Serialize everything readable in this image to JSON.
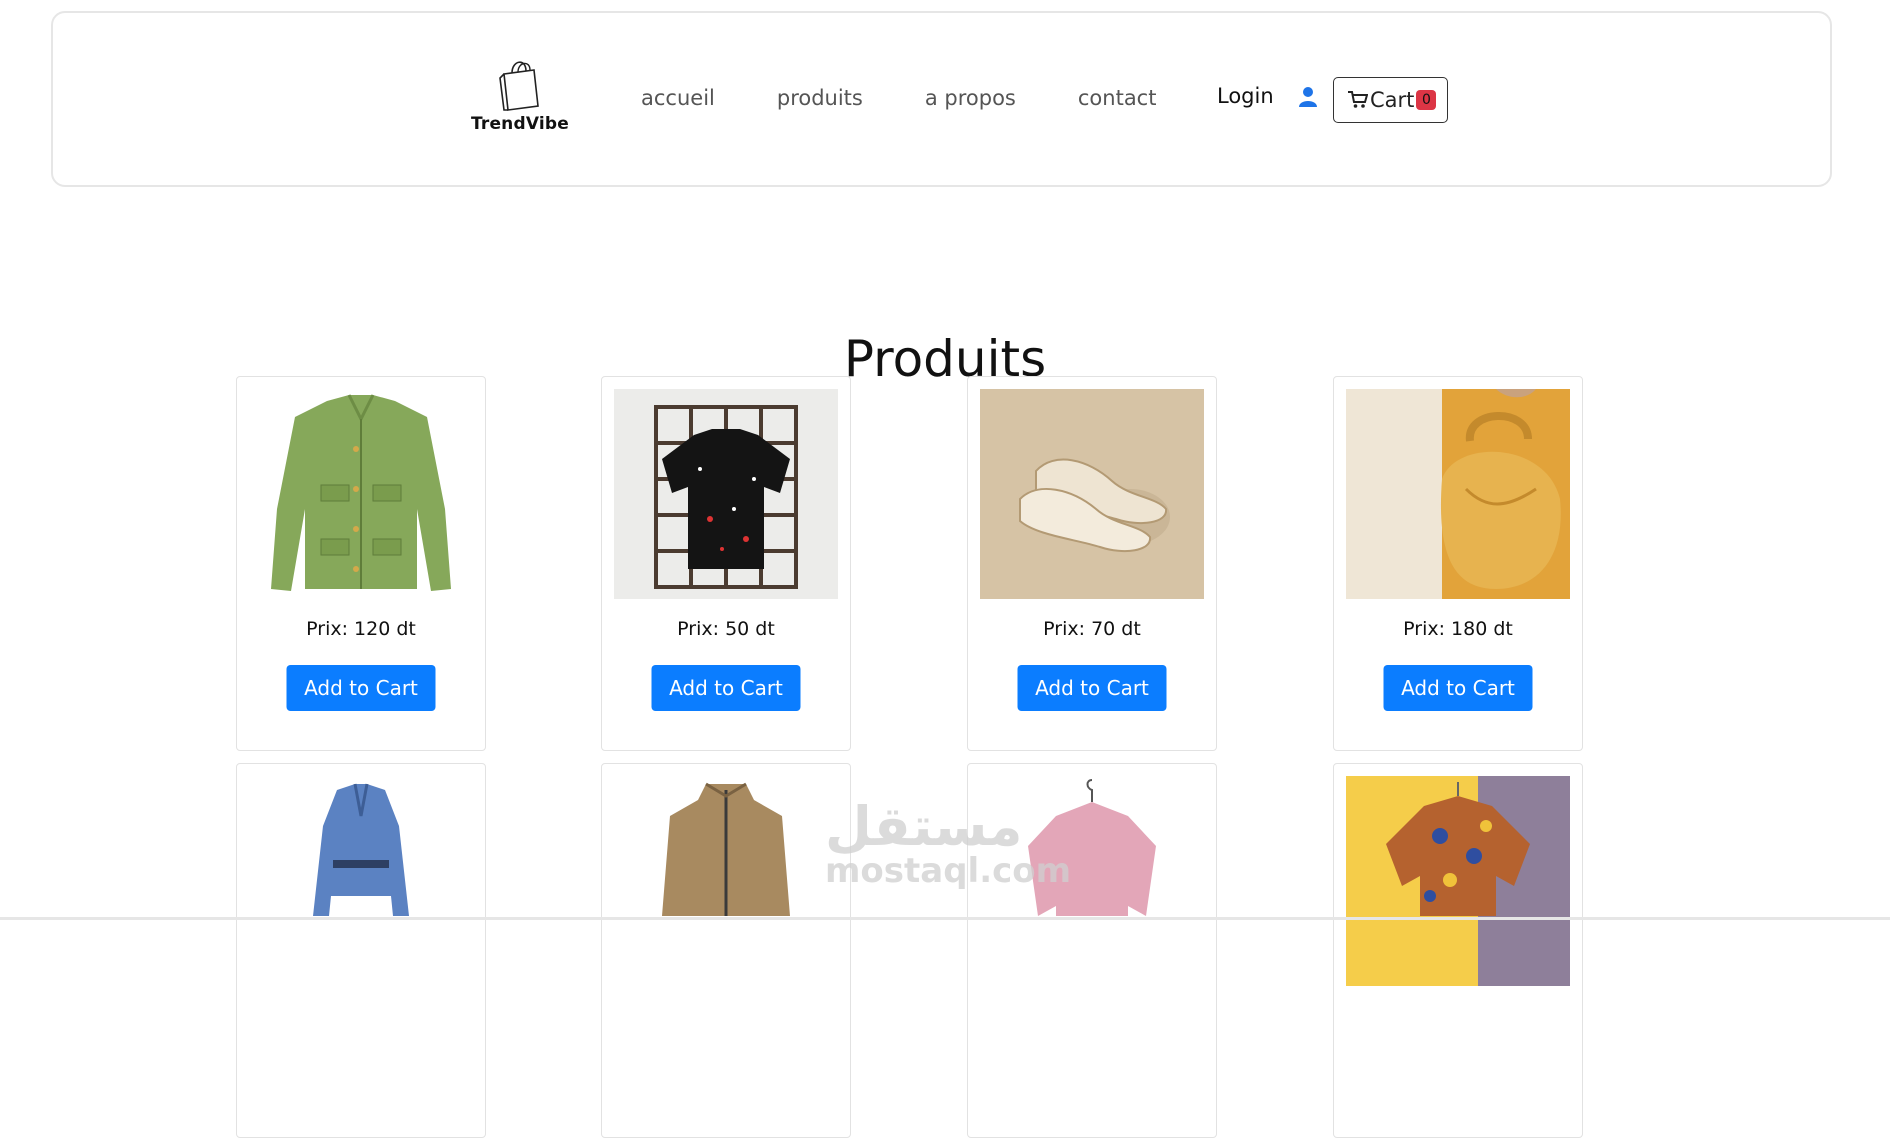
{
  "brand": {
    "name": "TrendVibe"
  },
  "nav": {
    "items": [
      "accueil",
      "produits",
      "a propos",
      "contact"
    ],
    "login_label": "Login",
    "cart_label": "Cart",
    "cart_count": "0"
  },
  "page": {
    "title": "Produits"
  },
  "products": [
    {
      "price": "Prix: 120 dt",
      "button": "Add to Cart",
      "image": "green-tweed-jacket"
    },
    {
      "price": "Prix: 50 dt",
      "button": "Add to Cart",
      "image": "black-graphic-tshirt"
    },
    {
      "price": "Prix: 70 dt",
      "button": "Add to Cart",
      "image": "cream-slip-on-shoes"
    },
    {
      "price": "Prix: 180 dt",
      "button": "Add to Cart",
      "image": "yellow-leather-handbag"
    },
    {
      "image": "blue-cutout-blazer-dress"
    },
    {
      "image": "khaki-zip-jacket"
    },
    {
      "image": "pink-sweatshirt"
    },
    {
      "image": "patterned-blouse"
    }
  ],
  "watermark": {
    "text_ar": "مستقل",
    "text": "mostaql.com"
  },
  "colors": {
    "primary_button": "#0b7dff",
    "badge": "#dc3545",
    "user_icon": "#1e74e8"
  }
}
